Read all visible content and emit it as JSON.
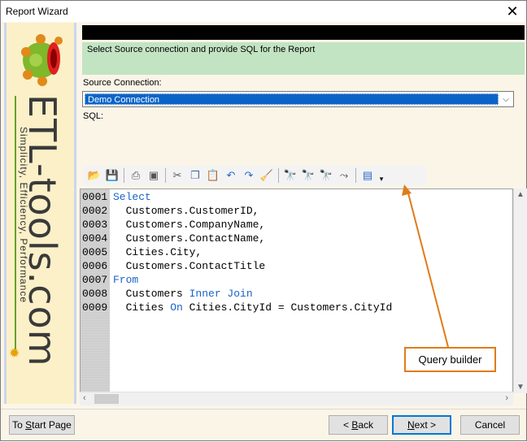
{
  "window": {
    "title": "Report Wizard",
    "close_glyph": "✕"
  },
  "sidebar": {
    "brand": "ETL-tools.com",
    "tagline": "Simplicity, Efficiency, Performance"
  },
  "info": {
    "text": "Select Source connection and provide SQL for the Report"
  },
  "source_connection": {
    "label": "Source Connection:",
    "value": "Demo Connection"
  },
  "sql": {
    "label": "SQL:"
  },
  "toolbar": {
    "buttons": [
      {
        "icon": "open-folder-icon"
      },
      {
        "icon": "save-icon"
      },
      {
        "icon": "print-icon"
      },
      {
        "icon": "print-preview-icon"
      },
      {
        "icon": "cut-icon"
      },
      {
        "icon": "copy-icon"
      },
      {
        "icon": "paste-icon"
      },
      {
        "icon": "undo-icon"
      },
      {
        "icon": "redo-icon"
      },
      {
        "icon": "clear-brush-icon"
      },
      {
        "icon": "find-icon"
      },
      {
        "icon": "find-next-icon"
      },
      {
        "icon": "replace-icon"
      },
      {
        "icon": "goto-icon"
      },
      {
        "icon": "query-builder-icon"
      }
    ]
  },
  "editor": {
    "lines": [
      {
        "num": "0001",
        "text": "Select",
        "kw": true
      },
      {
        "num": "0002",
        "text": "  Customers.CustomerID,"
      },
      {
        "num": "0003",
        "text": "  Customers.CompanyName,"
      },
      {
        "num": "0004",
        "text": "  Customers.ContactName,"
      },
      {
        "num": "0005",
        "text": "  Cities.City,"
      },
      {
        "num": "0006",
        "text": "  Customers.ContactTitle"
      },
      {
        "num": "0007",
        "text": "From",
        "kw": true
      },
      {
        "num": "0008",
        "pre": "  Customers ",
        "kwtext": "Inner Join",
        "post": ""
      },
      {
        "num": "0009",
        "pre": "  Cities ",
        "kwtext": "On",
        "post": " Cities.CityId = Customers.CityId"
      }
    ]
  },
  "annotation": {
    "label": "Query builder",
    "color": "#e07b1a"
  },
  "buttons": {
    "start": "To Start Page",
    "back": "< Back",
    "next": "Next >",
    "cancel": "Cancel"
  }
}
